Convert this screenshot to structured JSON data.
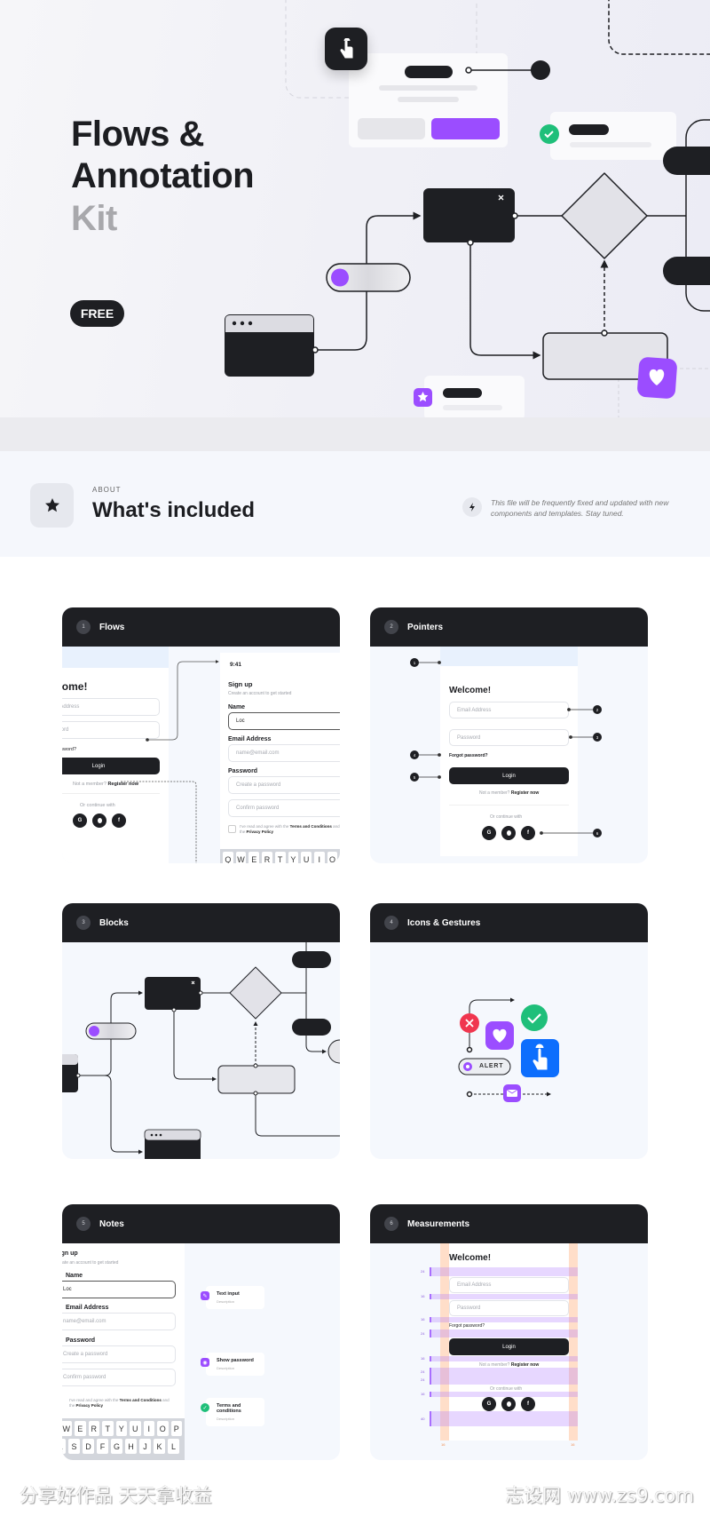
{
  "hero": {
    "title_line1": "Flows &",
    "title_line2": "Annotation",
    "title_line3": "Kit",
    "badge": "FREE"
  },
  "about": {
    "eyebrow": "ABOUT",
    "title": "What's included",
    "note": "This file will be frequently fixed and updated with new components and templates. Stay tuned.",
    "icon": "star-icon",
    "note_icon": "bolt-icon"
  },
  "cards": [
    {
      "number": "1",
      "title": "Flows"
    },
    {
      "number": "2",
      "title": "Pointers"
    },
    {
      "number": "3",
      "title": "Blocks"
    },
    {
      "number": "4",
      "title": "Icons & Gestures"
    },
    {
      "number": "5",
      "title": "Notes"
    },
    {
      "number": "6",
      "title": "Measurements"
    }
  ],
  "login": {
    "welcome": "Welcome!",
    "email_placeholder": "Email Address",
    "password_placeholder": "Password",
    "forgot": "Forgot password?",
    "login": "Login",
    "not_member": "Not a member?",
    "register": "Register now",
    "or_continue": "Or continue with",
    "google": "G",
    "facebook": "f"
  },
  "signup": {
    "time": "9:41",
    "title": "Sign up",
    "subtitle": "Create an account to get started",
    "name_label": "Name",
    "name_value": "Loc",
    "email_label": "Email Address",
    "email_placeholder": "name@email.com",
    "password_label": "Password",
    "password_placeholder": "Create a password",
    "confirm_placeholder": "Confirm password",
    "terms_prefix": "I've read and agree with the",
    "terms_link": "Terms and Conditions",
    "terms_mid": "and the",
    "privacy": "Privacy Policy",
    "keyboard_rows": [
      "QWERTYUIOP",
      "ASDFGHJKL"
    ]
  },
  "pointers": [
    "1",
    "2",
    "3",
    "4",
    "5",
    "6"
  ],
  "icons": {
    "alert": "ALERT"
  },
  "notes": [
    {
      "title": "Text input",
      "description": "Description",
      "color": "#9b4dff"
    },
    {
      "title": "Show password",
      "description": "Description",
      "color": "#9b4dff"
    },
    {
      "title": "Terms and conditions",
      "description": "Description",
      "color": "#1fbf7a"
    }
  ],
  "measurements": {
    "spacings": [
      "24",
      "16",
      "16",
      "24",
      "16",
      "24",
      "24",
      "16",
      "40"
    ],
    "side_left": "16",
    "side_right": "16"
  },
  "colors": {
    "dark": "#1e1f23",
    "purple": "#9b4dff",
    "green": "#1fbf7a",
    "red": "#f0364f",
    "blue": "#0d6efd"
  },
  "footer": {
    "left": "分享好作品 天天拿收益",
    "right": "志设网 www.zs9.com"
  }
}
